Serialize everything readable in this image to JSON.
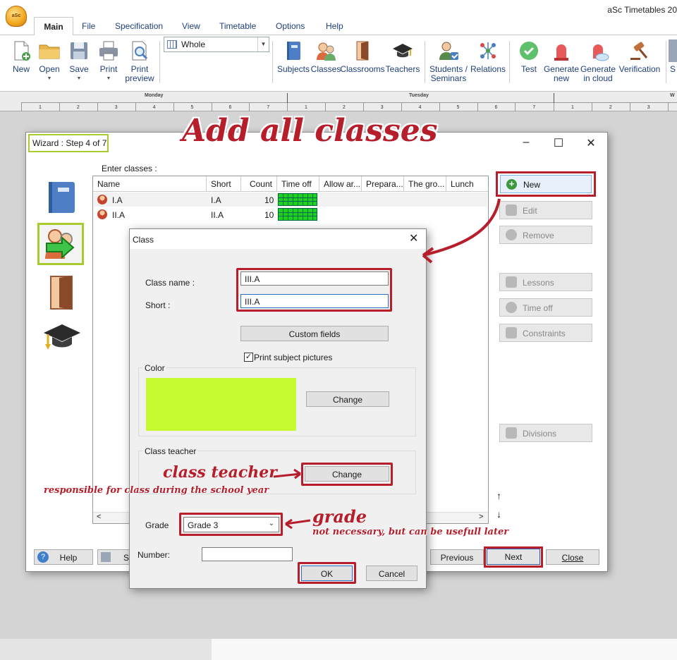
{
  "app": {
    "title": "aSc Timetables 20"
  },
  "ribbon": {
    "tabs": [
      "Main",
      "File",
      "Specification",
      "View",
      "Timetable",
      "Options",
      "Help"
    ],
    "buttons": {
      "new": "New",
      "open": "Open",
      "save": "Save",
      "print": "Print",
      "print_preview_1": "Print",
      "print_preview_2": "preview",
      "subjects": "Subjects",
      "classes": "Classes",
      "classrooms": "Classrooms",
      "teachers": "Teachers",
      "students_1": "Students /",
      "students_2": "Seminars",
      "relations": "Relations",
      "test": "Test",
      "generate_new_1": "Generate",
      "generate_new_2": "new",
      "generate_cloud_1": "Generate",
      "generate_cloud_2": "in cloud",
      "verification": "Verification",
      "more": "S"
    },
    "view_select": "Whole"
  },
  "timetable": {
    "days": [
      "Monday",
      "Tuesday",
      "W"
    ],
    "periods": [
      "1",
      "2",
      "3",
      "4",
      "5",
      "6",
      "7"
    ]
  },
  "wizard": {
    "title": "Wizard : Step 4 of 7",
    "enter_label": "Enter classes :",
    "columns": [
      "Name",
      "Short",
      "Count",
      "Time off",
      "Allow ar...",
      "Prepara...",
      "The gro...",
      "Lunch"
    ],
    "rows": [
      {
        "name": "I.A",
        "short": "I.A",
        "count": "10"
      },
      {
        "name": "II.A",
        "short": "II.A",
        "count": "10"
      }
    ],
    "side_buttons": {
      "new": "New",
      "edit": "Edit",
      "remove": "Remove",
      "lessons": "Lessons",
      "time_off": "Time off",
      "constraints": "Constraints",
      "divisions": "Divisions"
    },
    "footer": {
      "help": "Help",
      "save": "Sa",
      "previous": "Previous",
      "next": "Next",
      "close": "Close"
    }
  },
  "dialog": {
    "title": "Class",
    "class_name_label": "Class name :",
    "class_name": "III.A",
    "short_label": "Short :",
    "short": "III.A",
    "custom_fields": "Custom fields",
    "print_pictures": "Print subject pictures",
    "color_label": "Color",
    "color_change": "Change",
    "color_value": "#c8fa32",
    "class_teacher_label": "Class teacher",
    "teacher_change": "Change",
    "grade_label": "Grade",
    "grade": "Grade 3",
    "number_label": "Number:",
    "number": "",
    "ok": "OK",
    "cancel": "Cancel"
  },
  "annotations": {
    "title": "Add all classes",
    "class_teacher": "class teacher",
    "class_teacher_desc": "responsible for class during the school year",
    "grade": "grade",
    "grade_desc": "not necessary, but can be usefull later"
  },
  "colors": {
    "annotation": "#b61e2b",
    "wizard_highlight": "#a8cc30"
  }
}
